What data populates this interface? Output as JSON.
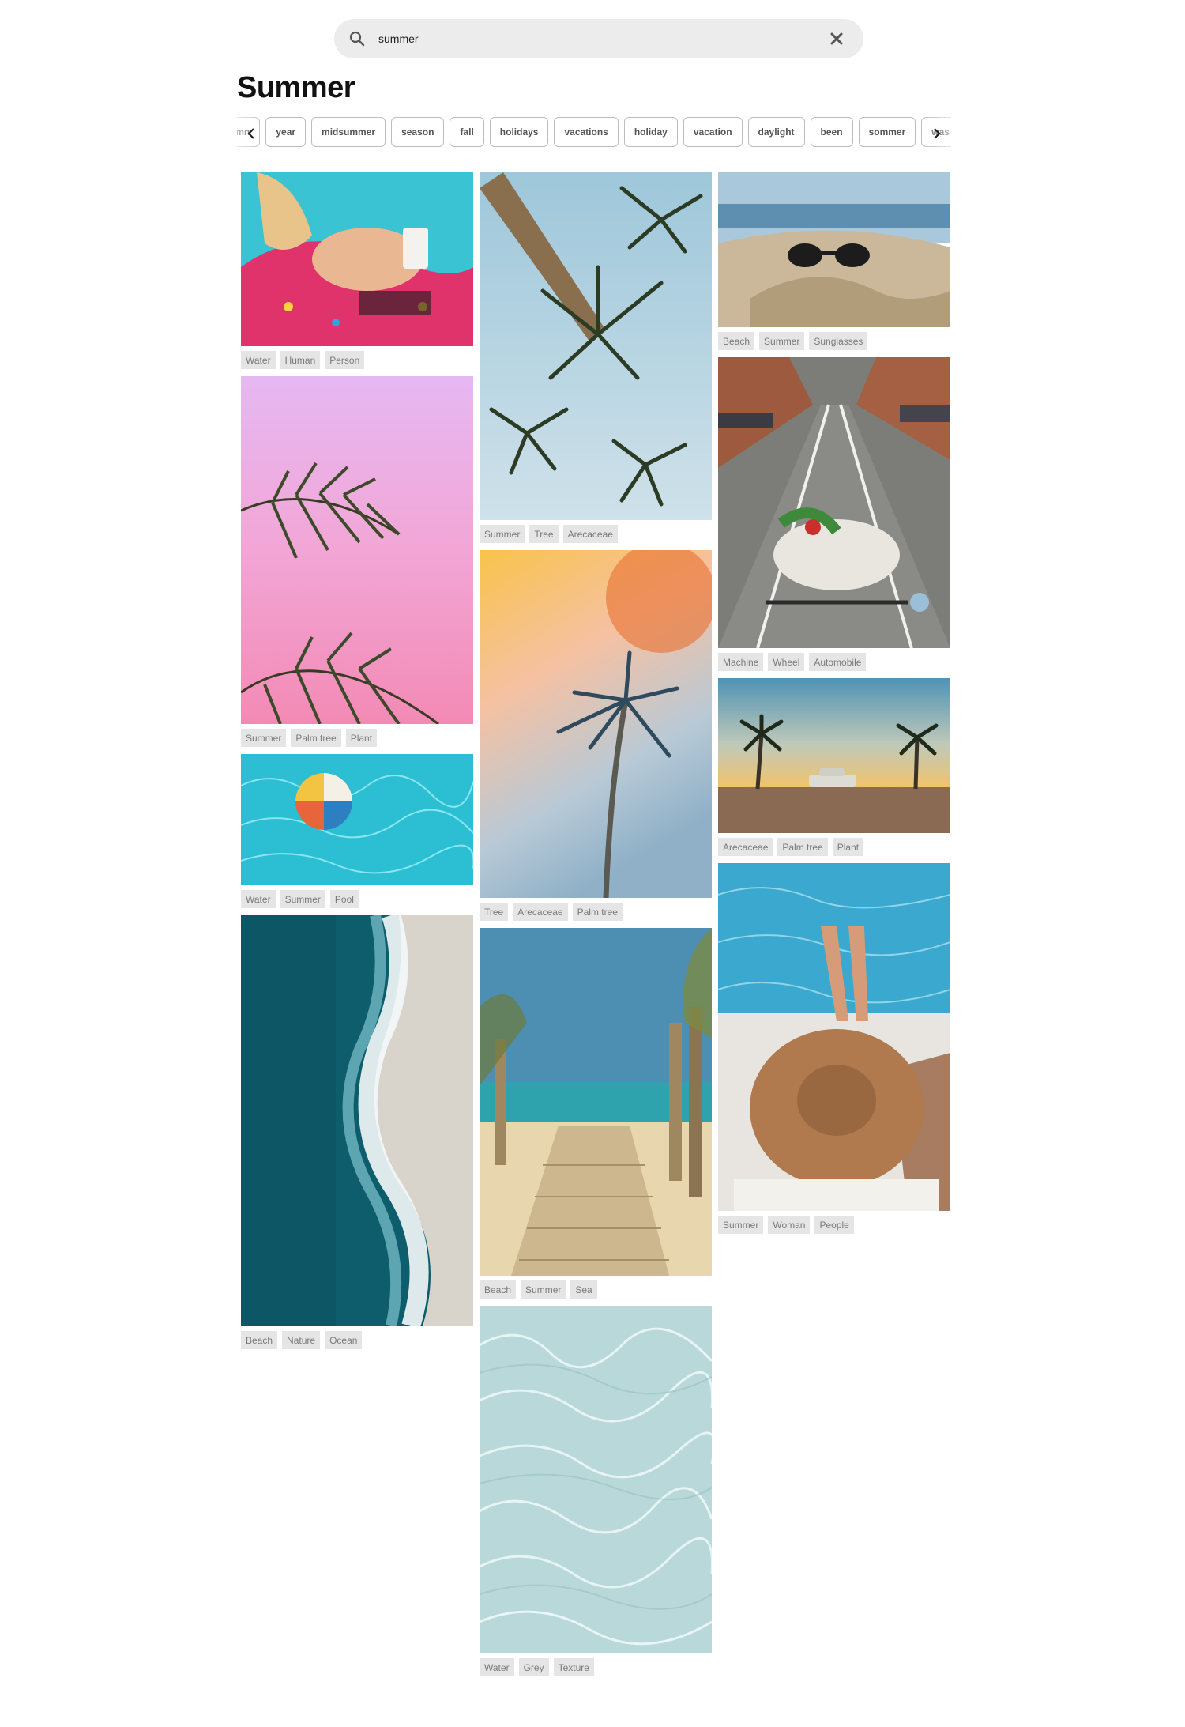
{
  "search": {
    "value": "summer",
    "placeholder": ""
  },
  "page_title": "Summer",
  "chips": [
    "umn",
    "year",
    "midsummer",
    "season",
    "fall",
    "holidays",
    "vacations",
    "holiday",
    "vacation",
    "daylight",
    "been",
    "sommer",
    "was"
  ],
  "columns": [
    [
      {
        "photo": "woman-on-donut-float",
        "tags": [
          "Water",
          "Human",
          "Person"
        ]
      },
      {
        "photo": "palm-leaves-pink-sky",
        "tags": [
          "Summer",
          "Palm tree",
          "Plant"
        ]
      },
      {
        "photo": "beach-ball-in-pool",
        "tags": [
          "Water",
          "Summer",
          "Pool"
        ]
      },
      {
        "photo": "aerial-beach-waves",
        "tags": [
          "Beach",
          "Nature",
          "Ocean"
        ]
      }
    ],
    [
      {
        "photo": "palm-trees-from-below",
        "tags": [
          "Summer",
          "Tree",
          "Arecaceae"
        ]
      },
      {
        "photo": "palm-tree-sunset-glow",
        "tags": [
          "Tree",
          "Arecaceae",
          "Palm tree"
        ]
      },
      {
        "photo": "boardwalk-to-beach",
        "tags": [
          "Beach",
          "Summer",
          "Sea"
        ]
      },
      {
        "photo": "clear-water-texture",
        "tags": [
          "Water",
          "Grey",
          "Texture"
        ]
      }
    ],
    [
      {
        "photo": "sunglasses-on-sand",
        "tags": [
          "Beach",
          "Summer",
          "Sunglasses"
        ]
      },
      {
        "photo": "bicycle-on-street",
        "tags": [
          "Machine",
          "Wheel",
          "Automobile"
        ]
      },
      {
        "photo": "car-between-palms",
        "tags": [
          "Arecaceae",
          "Palm tree",
          "Plant"
        ]
      },
      {
        "photo": "woman-straw-hat-pool",
        "tags": [
          "Summer",
          "Woman",
          "People"
        ]
      }
    ]
  ],
  "icons": {
    "search": "search-icon",
    "clear": "close-icon",
    "prev": "chevron-left-icon",
    "next": "chevron-right-icon"
  }
}
